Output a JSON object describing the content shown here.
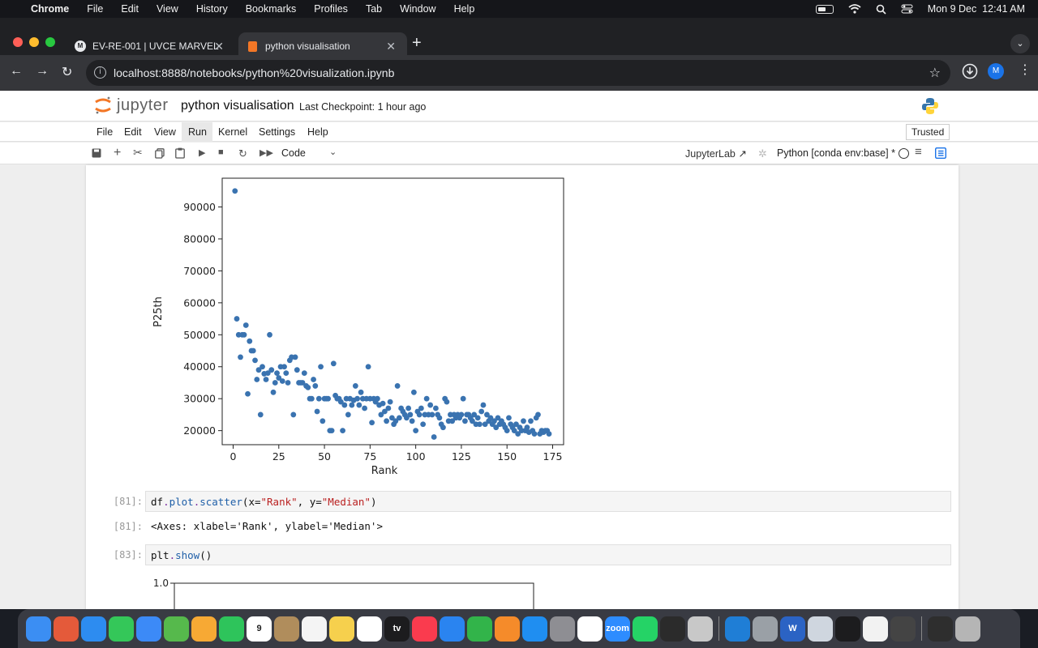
{
  "menubar": {
    "app": "Chrome",
    "items": [
      "File",
      "Edit",
      "View",
      "History",
      "Bookmarks",
      "Profiles",
      "Tab",
      "Window",
      "Help"
    ],
    "datetime": "Mon 9 Dec  12:41 AM"
  },
  "browser": {
    "tabs": [
      {
        "title": "EV-RE-001 | UVCE MARVEL",
        "icon": "marvel-favicon"
      },
      {
        "title": "python visualisation",
        "icon": "jupyter-notebook-favicon"
      }
    ],
    "url": "localhost:8888/notebooks/python%20visualization.ipynb",
    "profile_initial": "M"
  },
  "jupyter": {
    "logo_text": "jupyter",
    "notebook_title": "python visualisation",
    "checkpoint": "Last Checkpoint: 1 hour ago",
    "menu": [
      "File",
      "Edit",
      "View",
      "Run",
      "Kernel",
      "Settings",
      "Help"
    ],
    "trusted": "Trusted",
    "cell_type": "Code",
    "jupyterlab_link": "JupyterLab",
    "kernel": "Python [conda env:base] *"
  },
  "cells": [
    {
      "prompt": "[81]:",
      "code_parts": [
        "df",
        ".",
        "plot",
        ".",
        "scatter",
        "(x=",
        "\"Rank\"",
        ", y=",
        "\"Median\"",
        ")"
      ]
    },
    {
      "prompt": "[81]:",
      "output": "<Axes: xlabel='Rank', ylabel='Median'>"
    },
    {
      "prompt": "[83]:",
      "code_parts": [
        "plt",
        ".",
        "show",
        "()"
      ]
    }
  ],
  "chart_data": {
    "type": "scatter",
    "xlabel": "Rank",
    "ylabel": "P25th",
    "xlim": [
      -6,
      181
    ],
    "ylim": [
      15600,
      99000
    ],
    "xticks": [
      0,
      25,
      50,
      75,
      100,
      125,
      150,
      175
    ],
    "yticks": [
      20000,
      30000,
      40000,
      50000,
      60000,
      70000,
      80000,
      90000
    ],
    "ytick_labels": [
      "20000",
      "30000",
      "40000",
      "50000",
      "60000",
      "70000",
      "80000",
      "90000"
    ],
    "color": "#3a73b0",
    "points": [
      [
        1,
        95000
      ],
      [
        2,
        55000
      ],
      [
        3,
        50000
      ],
      [
        4,
        43000
      ],
      [
        5,
        50000
      ],
      [
        6,
        50000
      ],
      [
        7,
        53000
      ],
      [
        8,
        31500
      ],
      [
        9,
        48000
      ],
      [
        10,
        45000
      ],
      [
        11,
        45000
      ],
      [
        12,
        42000
      ],
      [
        13,
        36000
      ],
      [
        14,
        39000
      ],
      [
        15,
        25000
      ],
      [
        16,
        40000
      ],
      [
        17,
        37800
      ],
      [
        18,
        36000
      ],
      [
        19,
        38000
      ],
      [
        20,
        50000
      ],
      [
        21,
        39000
      ],
      [
        22,
        32000
      ],
      [
        23,
        35000
      ],
      [
        24,
        38000
      ],
      [
        25,
        36500
      ],
      [
        26,
        40000
      ],
      [
        27,
        35500
      ],
      [
        28,
        40000
      ],
      [
        29,
        38000
      ],
      [
        30,
        35000
      ],
      [
        31,
        42000
      ],
      [
        32,
        43000
      ],
      [
        33,
        25000
      ],
      [
        34,
        43000
      ],
      [
        35,
        39000
      ],
      [
        36,
        35000
      ],
      [
        37,
        35000
      ],
      [
        38,
        35000
      ],
      [
        39,
        38000
      ],
      [
        40,
        34000
      ],
      [
        41,
        33500
      ],
      [
        42,
        30000
      ],
      [
        43,
        30000
      ],
      [
        44,
        36000
      ],
      [
        45,
        34000
      ],
      [
        46,
        26000
      ],
      [
        47,
        30000
      ],
      [
        48,
        40000
      ],
      [
        49,
        23000
      ],
      [
        50,
        30000
      ],
      [
        51,
        30000
      ],
      [
        52,
        30000
      ],
      [
        53,
        20000
      ],
      [
        54,
        20000
      ],
      [
        55,
        41000
      ],
      [
        56,
        31000
      ],
      [
        57,
        30000
      ],
      [
        58,
        30000
      ],
      [
        59,
        29000
      ],
      [
        60,
        20000
      ],
      [
        61,
        28000
      ],
      [
        62,
        30000
      ],
      [
        63,
        25000
      ],
      [
        64,
        30000
      ],
      [
        65,
        28000
      ],
      [
        66,
        29500
      ],
      [
        67,
        34000
      ],
      [
        68,
        30000
      ],
      [
        69,
        28000
      ],
      [
        70,
        32000
      ],
      [
        71,
        30000
      ],
      [
        72,
        27000
      ],
      [
        73,
        30000
      ],
      [
        74,
        40000
      ],
      [
        75,
        30000
      ],
      [
        76,
        22500
      ],
      [
        77,
        30000
      ],
      [
        78,
        29000
      ],
      [
        79,
        30000
      ],
      [
        80,
        28000
      ],
      [
        81,
        25000
      ],
      [
        82,
        28500
      ],
      [
        83,
        26000
      ],
      [
        84,
        23000
      ],
      [
        85,
        27000
      ],
      [
        86,
        29000
      ],
      [
        87,
        24000
      ],
      [
        88,
        22000
      ],
      [
        89,
        23000
      ],
      [
        90,
        34000
      ],
      [
        91,
        24000
      ],
      [
        92,
        27000
      ],
      [
        93,
        26000
      ],
      [
        94,
        25000
      ],
      [
        95,
        24000
      ],
      [
        96,
        27000
      ],
      [
        97,
        25000
      ],
      [
        98,
        23000
      ],
      [
        99,
        32000
      ],
      [
        100,
        20000
      ],
      [
        101,
        26000
      ],
      [
        102,
        25000
      ],
      [
        103,
        27000
      ],
      [
        104,
        22000
      ],
      [
        105,
        25000
      ],
      [
        106,
        30000
      ],
      [
        107,
        25000
      ],
      [
        108,
        28000
      ],
      [
        109,
        25000
      ],
      [
        110,
        18000
      ],
      [
        111,
        27000
      ],
      [
        112,
        25000
      ],
      [
        113,
        24000
      ],
      [
        114,
        22000
      ],
      [
        115,
        21000
      ],
      [
        116,
        30000
      ],
      [
        117,
        29000
      ],
      [
        118,
        23000
      ],
      [
        119,
        25000
      ],
      [
        120,
        23000
      ],
      [
        121,
        25000
      ],
      [
        122,
        24000
      ],
      [
        123,
        25000
      ],
      [
        124,
        24000
      ],
      [
        125,
        25000
      ],
      [
        126,
        30000
      ],
      [
        127,
        23000
      ],
      [
        128,
        25000
      ],
      [
        129,
        25000
      ],
      [
        130,
        24000
      ],
      [
        131,
        23000
      ],
      [
        132,
        25000
      ],
      [
        133,
        22000
      ],
      [
        134,
        24000
      ],
      [
        135,
        22000
      ],
      [
        136,
        26000
      ],
      [
        137,
        28000
      ],
      [
        138,
        22000
      ],
      [
        139,
        25000
      ],
      [
        140,
        23000
      ],
      [
        141,
        24000
      ],
      [
        142,
        22000
      ],
      [
        143,
        23000
      ],
      [
        144,
        21000
      ],
      [
        145,
        24000
      ],
      [
        146,
        22000
      ],
      [
        147,
        23000
      ],
      [
        148,
        22000
      ],
      [
        149,
        21000
      ],
      [
        150,
        20000
      ],
      [
        151,
        24000
      ],
      [
        152,
        22000
      ],
      [
        153,
        21000
      ],
      [
        154,
        20000
      ],
      [
        155,
        22000
      ],
      [
        156,
        19000
      ],
      [
        157,
        21000
      ],
      [
        158,
        20000
      ],
      [
        159,
        23000
      ],
      [
        160,
        20000
      ],
      [
        161,
        21000
      ],
      [
        162,
        19500
      ],
      [
        163,
        23000
      ],
      [
        164,
        20000
      ],
      [
        165,
        19000
      ],
      [
        166,
        24000
      ],
      [
        167,
        25000
      ],
      [
        168,
        19000
      ],
      [
        169,
        20000
      ],
      [
        170,
        19500
      ],
      [
        171,
        20000
      ],
      [
        172,
        20000
      ],
      [
        173,
        19000
      ]
    ]
  },
  "chart2": {
    "ytick_label": "1.0"
  },
  "dock": {
    "apps": [
      {
        "icon": "finder-icon",
        "color": "#3b8ef3"
      },
      {
        "icon": "launchpad-icon",
        "color": "#e45a3a"
      },
      {
        "icon": "safari-icon",
        "color": "#2d8cf0"
      },
      {
        "icon": "messages-icon",
        "color": "#34c759"
      },
      {
        "icon": "mail-icon",
        "color": "#3c8af7"
      },
      {
        "icon": "maps-icon",
        "color": "#56b94c"
      },
      {
        "icon": "photos-icon",
        "color": "#f7a934"
      },
      {
        "icon": "facetime-icon",
        "color": "#2ec45b"
      },
      {
        "icon": "calendar-icon",
        "color": "#ffffff",
        "label": "9"
      },
      {
        "icon": "contacts-icon",
        "color": "#b08d5c"
      },
      {
        "icon": "reminders-icon",
        "color": "#f4f4f4"
      },
      {
        "icon": "notes-icon",
        "color": "#f6d04d"
      },
      {
        "icon": "freeform-icon",
        "color": "#ffffff"
      },
      {
        "icon": "appletv-icon",
        "color": "#1c1c1e",
        "label": "tv"
      },
      {
        "icon": "music-icon",
        "color": "#fa3b4e"
      },
      {
        "icon": "keynote-icon",
        "color": "#2a84f0"
      },
      {
        "icon": "numbers-icon",
        "color": "#32b44a"
      },
      {
        "icon": "pages-icon",
        "color": "#f58b2a"
      },
      {
        "icon": "appstore-icon",
        "color": "#1f8ef1"
      },
      {
        "icon": "system-settings-icon",
        "color": "#8e8e93"
      },
      {
        "icon": "chrome-icon",
        "color": "#ffffff"
      },
      {
        "icon": "zoom-icon",
        "color": "#2d8cff",
        "label": "zoom"
      },
      {
        "icon": "whatsapp-icon",
        "color": "#25d366"
      },
      {
        "icon": "terminal-icon",
        "color": "#2b2b2b"
      },
      {
        "icon": "python-launcher-icon",
        "color": "#c8c8c8"
      },
      {
        "icon": "vscode-icon",
        "color": "#1f7ed6"
      },
      {
        "icon": "xcode-tools-icon",
        "color": "#9aa0a6"
      },
      {
        "icon": "word-icon",
        "color": "#2b63c4",
        "label": "W"
      },
      {
        "icon": "preview-icon",
        "color": "#cfd6df"
      },
      {
        "icon": "activity-ring-icon",
        "color": "#1c1c1e"
      },
      {
        "icon": "document-icon",
        "color": "#f2f2f2"
      },
      {
        "icon": "window-thumbnail-icon",
        "color": "#444444"
      },
      {
        "icon": "window-thumbnail-icon",
        "color": "#2e2e2e"
      },
      {
        "icon": "trash-icon",
        "color": "#b5b5b5"
      }
    ]
  }
}
